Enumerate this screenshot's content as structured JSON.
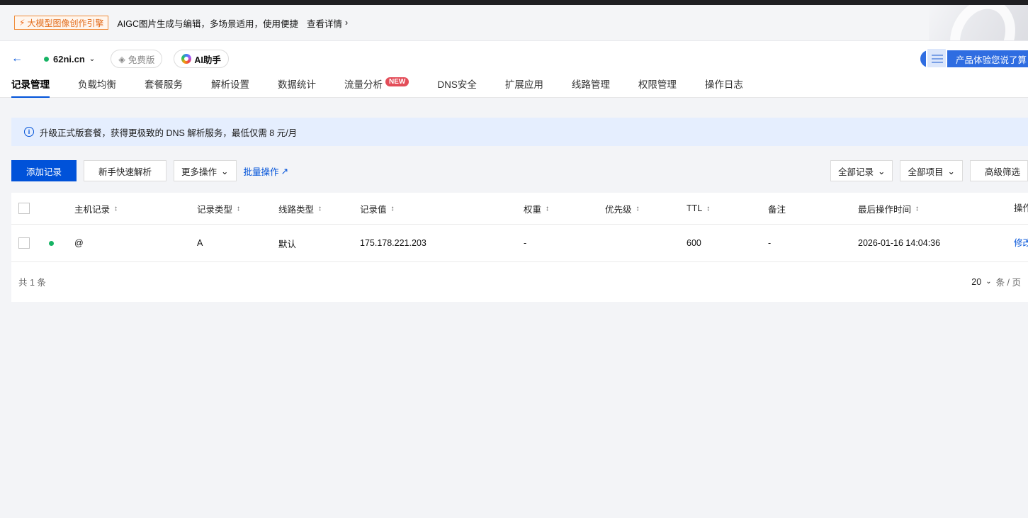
{
  "promo": {
    "badge": "大模型图像创作引擎",
    "text": "AIGC图片生成与编辑，多场景适用，使用便捷",
    "link": "查看详情"
  },
  "header": {
    "domain": "62ni.cn",
    "free_label": "免费版",
    "ai_label": "AI助手",
    "feedback": "产品体验您说了算"
  },
  "tabs": [
    {
      "label": "记录管理"
    },
    {
      "label": "负载均衡"
    },
    {
      "label": "套餐服务"
    },
    {
      "label": "解析设置"
    },
    {
      "label": "数据统计"
    },
    {
      "label": "流量分析",
      "badge": "NEW"
    },
    {
      "label": "DNS安全"
    },
    {
      "label": "扩展应用"
    },
    {
      "label": "线路管理"
    },
    {
      "label": "权限管理"
    },
    {
      "label": "操作日志"
    }
  ],
  "notice": "升级正式版套餐，获得更极致的 DNS 解析服务，最低仅需 8 元/月",
  "toolbar": {
    "add": "添加记录",
    "quick": "新手快速解析",
    "more": "更多操作",
    "batch": "批量操作",
    "all_records": "全部记录",
    "all_items": "全部项目",
    "advanced": "高级筛选"
  },
  "table": {
    "headers": {
      "host": "主机记录",
      "type": "记录类型",
      "line": "线路类型",
      "value": "记录值",
      "weight": "权重",
      "priority": "优先级",
      "ttl": "TTL",
      "remark": "备注",
      "time": "最后操作时间",
      "action": "操作"
    },
    "rows": [
      {
        "host": "@",
        "type": "A",
        "line": "默认",
        "value": "175.178.221.203",
        "weight": "-",
        "priority": "",
        "ttl": "600",
        "remark": "-",
        "time": "2026-01-16 14:04:36",
        "action": "修改"
      }
    ],
    "total": "共 1 条",
    "page_size": "20",
    "page_unit": "条 / 页"
  },
  "colors": {
    "primary": "#0052d9",
    "status_ok": "#16b364",
    "badge_new": "#e34d59"
  }
}
